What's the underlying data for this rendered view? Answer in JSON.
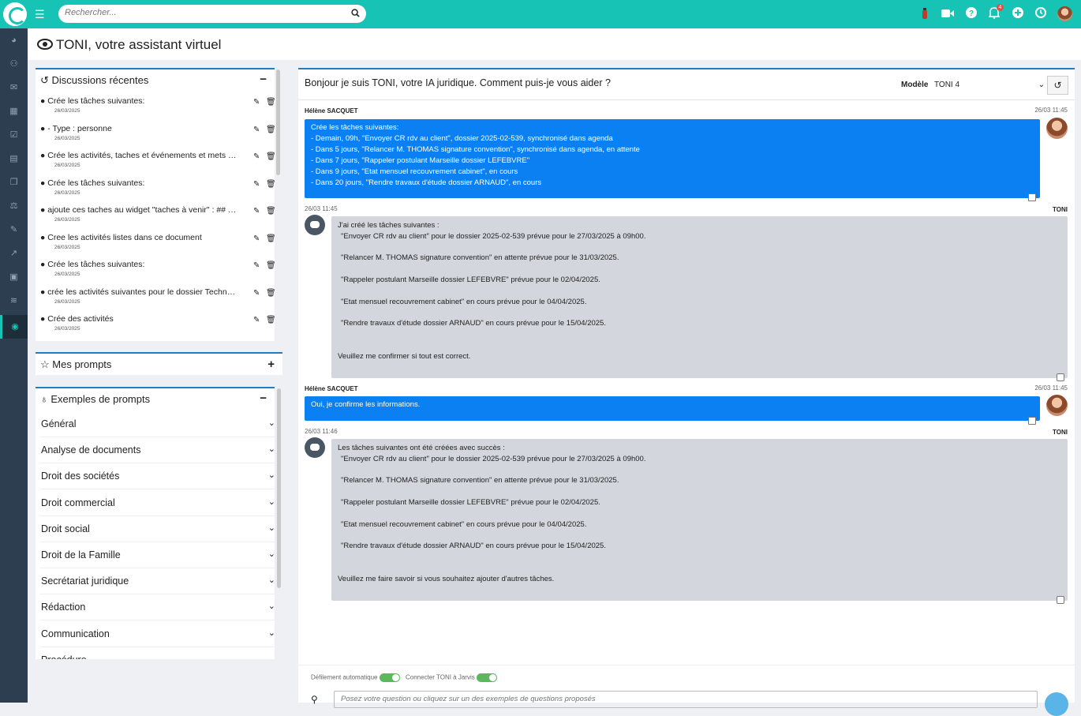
{
  "topbar": {
    "search_placeholder": "Rechercher...",
    "notification_count": "4"
  },
  "page": {
    "title": "TONI, votre assistant virtuel"
  },
  "recent": {
    "title": "Discussions récentes",
    "collapse": "−",
    "items": [
      {
        "text": "Crée les tâches suivantes:",
        "date": "26/03/2025"
      },
      {
        "text": "- Type : personne",
        "date": "26/03/2025"
      },
      {
        "text": "Crée les activités, taches et événements et mets l'...",
        "date": "26/03/2025"
      },
      {
        "text": "Crée les tâches suivantes:",
        "date": "26/03/2025"
      },
      {
        "text": "ajoute ces taches au widget \"taches à venir\" : ## T...",
        "date": "26/03/2025"
      },
      {
        "text": "Cree les activités listes dans ce document",
        "date": "26/03/2025"
      },
      {
        "text": "Crée les tâches suivantes:",
        "date": "26/03/2025"
      },
      {
        "text": "crée les activités suivantes pour le dossier Technol...",
        "date": "26/03/2025"
      },
      {
        "text": "Crée des activités",
        "date": "26/03/2025"
      }
    ]
  },
  "myprompts": {
    "title": "Mes prompts",
    "add": "+"
  },
  "examples": {
    "title": "Exemples de prompts",
    "collapse": "−",
    "categories": [
      "Général",
      "Analyse de documents",
      "Droit des sociétés",
      "Droit commercial",
      "Droit social",
      "Droit de la Famille",
      "Secrétariat juridique",
      "Rédaction",
      "Communication",
      "Procédure"
    ]
  },
  "chat": {
    "greeting": "Bonjour je suis TONI, votre IA juridique. Comment puis-je vous aider ?",
    "model_label": "Modèle",
    "model_value": "TONI 4",
    "messages": [
      {
        "author": "Hélène SACQUET",
        "time": "26/03 11:45",
        "lines": [
          "Crée les tâches suivantes:",
          "- Demain, 09h, \"Envoyer CR rdv au client\", dossier 2025-02-539, synchronisé dans agenda",
          "- Dans 5 jours, \"Relancer M. THOMAS signature convention\", synchronisé dans agenda, en attente",
          "- Dans 7 jours, \"Rappeler postulant Marseille dossier LEFEBVRE\"",
          "- Dans 9 jours, \"Etat mensuel recouvrement cabinet\", en cours",
          "- Dans 20 jours, \"Rendre travaux d'étude dossier ARNAUD\", en cours"
        ]
      },
      {
        "author": "TONI",
        "time": "26/03 11:45",
        "intro": "J'ai créé les tâches suivantes :",
        "lines": [
          "\"Envoyer CR rdv au client\" pour le dossier 2025-02-539 prévue pour le 27/03/2025 à 09h00.",
          "\"Relancer M. THOMAS signature convention\" en attente prévue pour le 31/03/2025.",
          "\"Rappeler postulant Marseille dossier LEFEBVRE\" prévue pour le 02/04/2025.",
          "\"Etat mensuel recouvrement cabinet\" en cours prévue pour le 04/04/2025.",
          "\"Rendre travaux d'étude dossier ARNAUD\" en cours prévue pour le 15/04/2025."
        ],
        "outro": "Veuillez me confirmer si tout est correct."
      },
      {
        "author": "Hélène SACQUET",
        "time": "26/03 11:45",
        "lines": [
          "Oui, je confirme les informations."
        ]
      },
      {
        "author": "TONI",
        "time": "26/03 11:46",
        "intro": "Les tâches suivantes ont été créées avec succès :",
        "lines": [
          "\"Envoyer CR rdv au client\" pour le dossier 2025-02-539 prévue pour le 27/03/2025 à 09h00.",
          "\"Relancer M. THOMAS signature convention\" en attente prévue pour le 31/03/2025.",
          "\"Rappeler postulant Marseille dossier LEFEBVRE\" prévue pour le 02/04/2025.",
          "\"Etat mensuel recouvrement cabinet\" en cours prévue pour le 04/04/2025.",
          "\"Rendre travaux d'étude dossier ARNAUD\" en cours prévue pour le 15/04/2025."
        ],
        "outro": "Veuillez me faire savoir si vous souhaitez ajouter d'autres tâches."
      }
    ],
    "toggle_autoscroll": "Défilement automatique",
    "toggle_jarvis": "Connecter TONI à Jarvis",
    "input_placeholder": "Posez votre question ou cliquez sur un des exemples de questions proposés"
  },
  "colors": {
    "accent": "#17c3b5",
    "sidebar": "#2c3e50",
    "user_bubble": "#0b80f2",
    "bot_bubble": "#d3d6dc"
  }
}
